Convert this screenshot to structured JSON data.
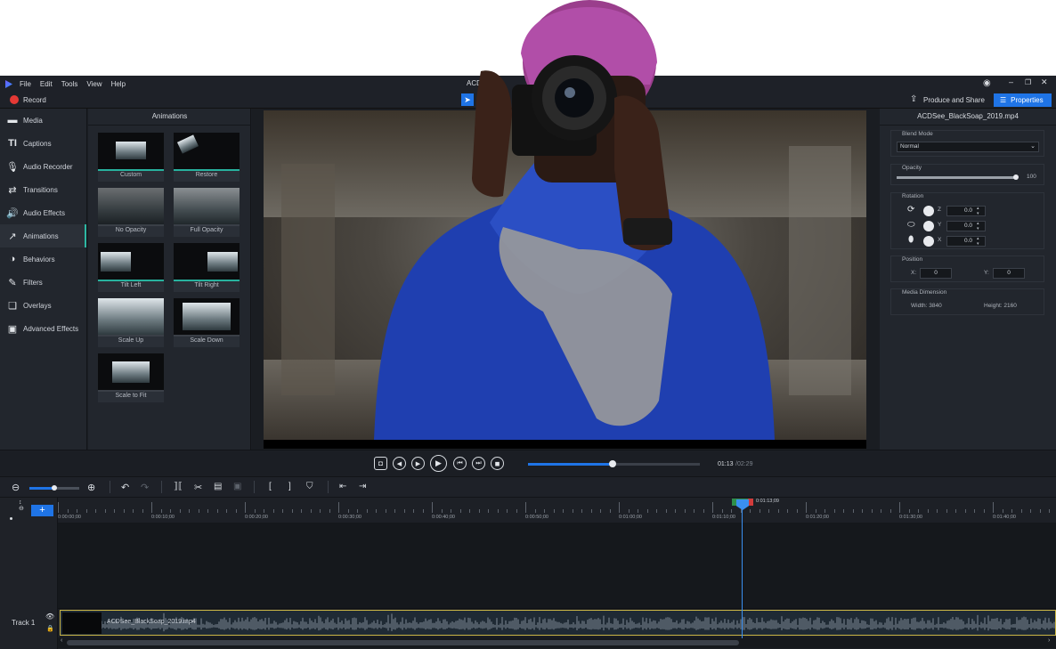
{
  "app": {
    "title": "ACDSee"
  },
  "menu": [
    "File",
    "Edit",
    "Tools",
    "View",
    "Help"
  ],
  "toolbar": {
    "record_label": "Record",
    "produce_label": "Produce and Share",
    "properties_label": "Properties"
  },
  "nav": {
    "items": [
      "Media",
      "Captions",
      "Audio Recorder",
      "Transitions",
      "Audio Effects",
      "Animations",
      "Behaviors",
      "Filters",
      "Overlays",
      "Advanced Effects"
    ],
    "active": "Animations"
  },
  "animations": {
    "title": "Animations",
    "tiles": [
      "Custom",
      "Restore",
      "No Opacity",
      "Full Opacity",
      "Tilt Left",
      "Tilt Right",
      "Scale Up",
      "Scale Down",
      "Scale to Fit"
    ]
  },
  "properties": {
    "filename": "ACDSee_BlackSoap_2019.mp4",
    "blend_mode_label": "Blend Mode",
    "blend_mode_value": "Normal",
    "opacity_label": "Opacity",
    "opacity_value": "100",
    "opacity_level": 1.0,
    "rotation_label": "Rotation",
    "rotation": [
      {
        "axis": "Z",
        "value": "0.0"
      },
      {
        "axis": "Y",
        "value": "0.0"
      },
      {
        "axis": "X",
        "value": "0.0"
      }
    ],
    "position_label": "Position",
    "pos_x_label": "X:",
    "pos_x": "0",
    "pos_y_label": "Y:",
    "pos_y": "0",
    "media_dim_label": "Media Dimension",
    "width_text": "Width: 3840",
    "height_text": "Height: 2160"
  },
  "transport": {
    "current_time": "01:13",
    "total_time": "/02:29",
    "progress": 0.49
  },
  "timeline": {
    "playhead_time": "0:01:13;09",
    "ruler_labels": [
      "0:00:00;00",
      "0:00:10;00",
      "0:00:20;00",
      "0:00:30;00",
      "0:00:40;00",
      "0:00:50;00",
      "0:01:00;00",
      "0:01:10;00",
      "0:01:20;00",
      "0:01:30;00",
      "0:01:40;00"
    ],
    "track_label": "Track 1",
    "clip_name": "ACDSee_BlackSoap_2019.mp4",
    "zoom_level": 0.5
  },
  "colors": {
    "accent": "#1f74e6",
    "teal": "#2db7a3",
    "record": "#e53935",
    "clip_border": "#c9b545"
  }
}
